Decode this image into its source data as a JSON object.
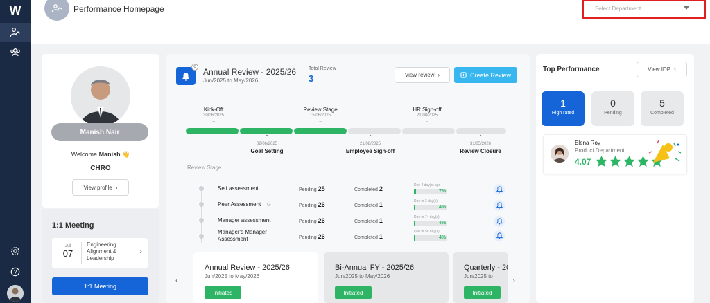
{
  "app": {
    "logo": "W"
  },
  "header": {
    "title": "Performance Homepage",
    "department_placeholder": "Select Department"
  },
  "profile": {
    "name": "Manish Nair",
    "welcome_prefix": "Welcome",
    "welcome_name": "Manish",
    "role": "CHRO",
    "view_profile": "View profile"
  },
  "meeting": {
    "title": "1:1 Meeting",
    "item": {
      "month": "Jul",
      "day": "07",
      "title": "Engineering Alignment & Leadership"
    },
    "button": "1:1 Meeting"
  },
  "review": {
    "notification_count": "0",
    "title": "Annual Review - 2025/26",
    "period": "Jun/2025 to May/2026",
    "total_label": "Total Review",
    "total_value": "3",
    "view_review": "View review",
    "create_review": "Create Review",
    "stages_top": [
      {
        "label": "Kick-Off",
        "date": "30/06/2025"
      },
      {
        "label": "Review Stage",
        "date": "15/06/2025"
      },
      {
        "label": "HR Sign-off",
        "date": "21/08/2025"
      }
    ],
    "stages_bottom": [
      {
        "label": "Goal Setting",
        "date": "02/06/2025"
      },
      {
        "label": "Employee Sign-off",
        "date": "21/08/2025"
      },
      {
        "label": "Review Closure",
        "date": "31/05/2026"
      }
    ],
    "progress_fraction": 0.5,
    "review_stage_title": "Review Stage",
    "rows": [
      {
        "name": "Self assessment",
        "pending_label": "Pending",
        "pending": "25",
        "completed_label": "Completed",
        "completed": "2",
        "due": "Due 4 day(s) ago",
        "pct": "7%"
      },
      {
        "name": "Peer Assessment",
        "pending_label": "Pending",
        "pending": "26",
        "completed_label": "Completed",
        "completed": "1",
        "due": "Due in 3 day(s)",
        "pct": "4%"
      },
      {
        "name": "Manager assessment",
        "pending_label": "Pending",
        "pending": "26",
        "completed_label": "Completed",
        "completed": "1",
        "due": "Due in 74 day(s)",
        "pct": "4%"
      },
      {
        "name": "Manager's Manager Assessment",
        "pending_label": "Pending",
        "pending": "26",
        "completed_label": "Completed",
        "completed": "1",
        "due": "Due in 58 day(s)",
        "pct": "4%"
      }
    ],
    "cycles": [
      {
        "title": "Annual Review - 2025/26",
        "period": "Jun/2025 to May/2026",
        "status": "Initiated"
      },
      {
        "title": "Bi-Annual FY - 2025/26",
        "period": "Jun/2025 to May/2026",
        "status": "Initiated"
      },
      {
        "title": "Quarterly - 20",
        "period": "Jun/2025 to",
        "status": "Initiated"
      }
    ]
  },
  "top_performance": {
    "title": "Top Performance",
    "view_idp": "View IDP",
    "tiles": [
      {
        "value": "1",
        "label": "High rated"
      },
      {
        "value": "0",
        "label": "Pending"
      },
      {
        "value": "5",
        "label": "Completed"
      }
    ],
    "performer": {
      "name": "Elena Roy",
      "department": "Product Department",
      "score": "4.07",
      "stars": 5
    }
  },
  "colors": {
    "primary": "#1565d8",
    "success": "#2db565",
    "nav": "#1b2a44",
    "highlight_border": "#e02020"
  }
}
